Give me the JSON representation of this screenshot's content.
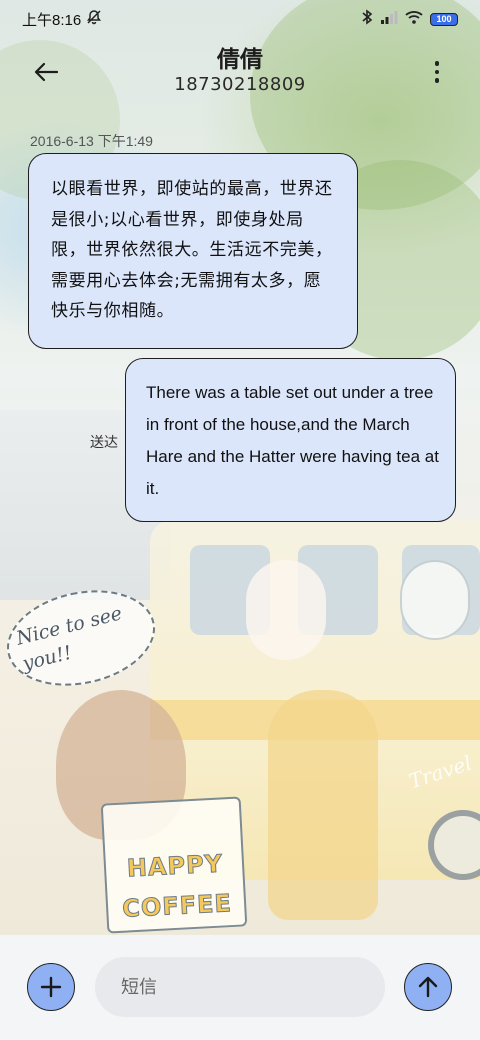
{
  "status_bar": {
    "time": "上午8:16",
    "battery": "100"
  },
  "header": {
    "contact_name": "倩倩",
    "phone_number": "18730218809"
  },
  "conversation": {
    "timestamp": "2016-6-13 下午1:49",
    "messages": [
      {
        "direction": "incoming",
        "text": "以眼看世界，即使站的最高，世界还是很小;以心看世界，即使身处局限，世界依然很大。生活远不完美，需要用心去体会;无需拥有太多，愿快乐与你相随。"
      },
      {
        "direction": "outgoing",
        "text": "There was a table set out under a tree in front of the house,and the March Hare and the Hatter were having tea at it."
      }
    ],
    "delivery_status": "送达"
  },
  "wallpaper": {
    "bubble_text": "Nice to see you!!",
    "sign_text": "HAPPY COFFEE",
    "bus_text": "Travel"
  },
  "compose": {
    "placeholder": "短信"
  },
  "colors": {
    "bubble": "#dbe6fb",
    "button": "#8fb0f3",
    "battery": "#3a6ee8"
  }
}
